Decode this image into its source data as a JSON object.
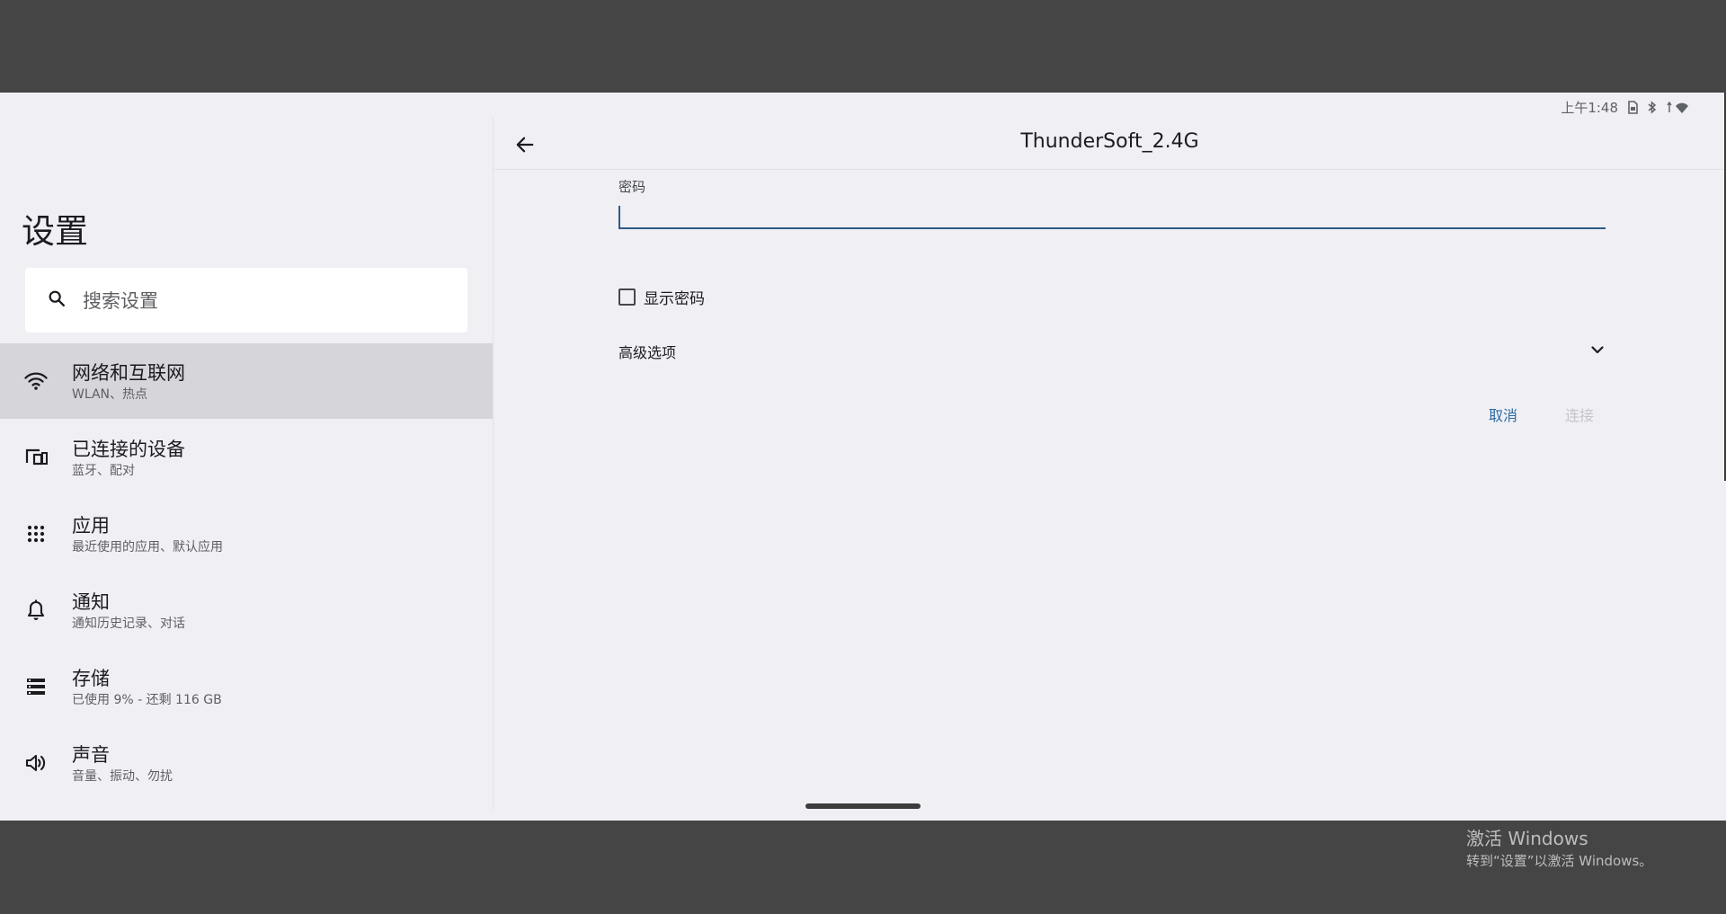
{
  "status_bar": {
    "time": "上午1:48"
  },
  "sidebar": {
    "title": "设置",
    "search_placeholder": "搜索设置",
    "items": [
      {
        "title": "网络和互联网",
        "subtitle": "WLAN、热点",
        "icon": "wifi-icon",
        "selected": true
      },
      {
        "title": "已连接的设备",
        "subtitle": "蓝牙、配对",
        "icon": "devices-icon",
        "selected": false
      },
      {
        "title": "应用",
        "subtitle": "最近使用的应用、默认应用",
        "icon": "apps-icon",
        "selected": false
      },
      {
        "title": "通知",
        "subtitle": "通知历史记录、对话",
        "icon": "bell-icon",
        "selected": false
      },
      {
        "title": "存储",
        "subtitle": "已使用 9% - 还剩 116 GB",
        "icon": "storage-icon",
        "selected": false
      },
      {
        "title": "声音",
        "subtitle": "音量、振动、勿扰",
        "icon": "volume-icon",
        "selected": false
      }
    ]
  },
  "dialog": {
    "title": "ThunderSoft_2.4G",
    "password_label": "密码",
    "password_value": "",
    "show_password_label": "显示密码",
    "show_password_checked": false,
    "advanced_label": "高级选项",
    "cancel_label": "取消",
    "connect_label": "连接"
  },
  "watermark": {
    "title": "激活 Windows",
    "subtitle": "转到“设置”以激活 Windows。"
  },
  "colors": {
    "accent": "#2e5b88",
    "selected_bg": "#d6d5da",
    "background": "#f0eff4",
    "frame": "#454545"
  }
}
